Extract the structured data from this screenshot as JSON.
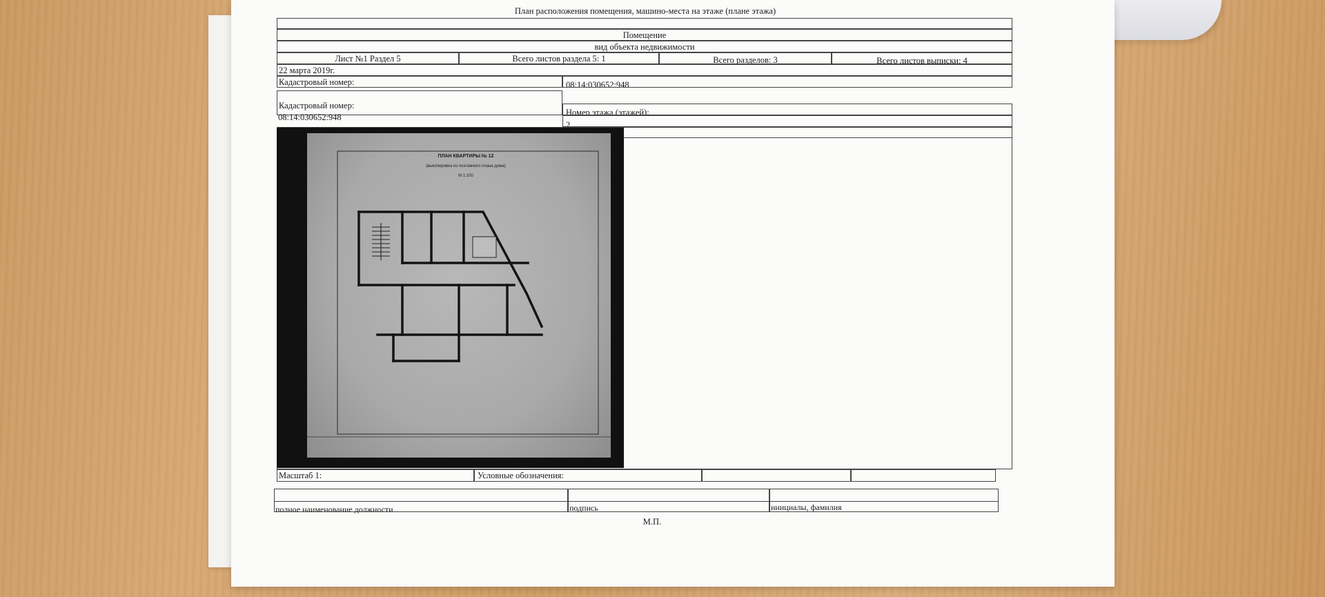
{
  "document": {
    "title": "План расположения помещения, машино-места на этаже (плане этажа)",
    "object_type": "Помещение",
    "object_type_caption": "вид объекта недвижимости",
    "sheet_section": "Лист №1  Раздел 5",
    "sheets_in_section": "Всего листов раздела 5: 1",
    "sections_total": "Всего разделов: 3",
    "extract_sheets_total": "Всего листов выписки: 4",
    "date": "22 марта 2019г.",
    "cadastral_label_1": "Кадастровый номер:",
    "cadastral_value_1": "08:14:030652:948",
    "cadastral_label_2": "Кадастровый номер:",
    "cadastral_value_2": "08:14:030652:948",
    "floor_label": "Номер этажа (этажей):",
    "floor_value": "2",
    "scale_label": "Масштаб 1:",
    "legend_label": "Условные обозначения:",
    "position_caption": "полное наименование должности",
    "signature_caption": "подпись",
    "initials_caption": "инициалы, фамилия",
    "stamp_caption": "М.П."
  },
  "floor_plan": {
    "title": "ПЛАН КВАРТИРЫ №  12",
    "subtitle": "(выкопировка из поэтажного плана дома)",
    "scale": "М 1:100"
  },
  "colors": {
    "wood": "#d2a26d",
    "paper": "#fbfbfa",
    "plan_background": "#111111",
    "plan_paper": "#b0b0b0"
  }
}
